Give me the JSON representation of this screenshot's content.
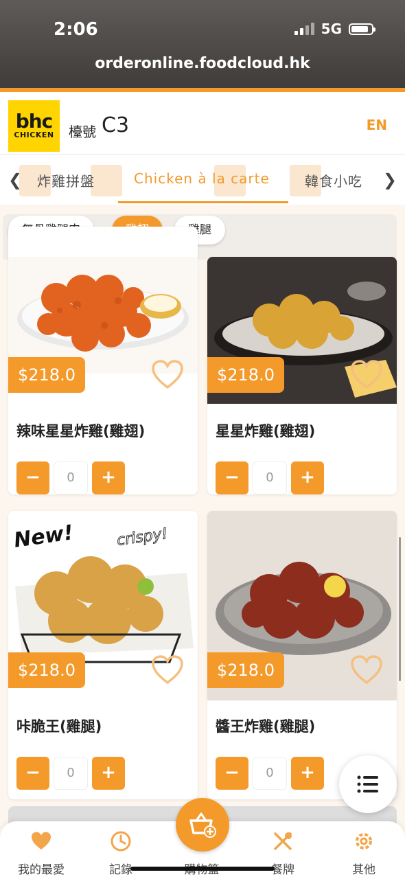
{
  "status_bar": {
    "time": "2:06",
    "network": "5G"
  },
  "browser": {
    "url": "orderonline.foodcloud.hk"
  },
  "header": {
    "logo_line1": "bhc",
    "logo_line2": "CHICKEN",
    "table_label": "檯號",
    "table_number": "C3",
    "lang_button": "EN"
  },
  "categories": {
    "items": [
      {
        "label": "炸雞拼盤"
      },
      {
        "label": "Chicken à la carte"
      },
      {
        "label": "韓食小吃"
      }
    ],
    "active": "Chicken à la carte"
  },
  "chips": [
    {
      "label": "無骨雞腿肉"
    },
    {
      "label": "雞翅"
    },
    {
      "label": "雞腿"
    }
  ],
  "products": [
    {
      "name": "辣味星星炸雞(雞翅)",
      "price": "$218.0",
      "qty": "0"
    },
    {
      "name": "星星炸雞(雞翅)",
      "price": "$218.0",
      "qty": "0"
    },
    {
      "name": "咔脆王(雞腿)",
      "price": "$218.0",
      "qty": "0",
      "badge_new": "New!",
      "badge_crispy": "crispy!"
    },
    {
      "name": "醬王炸雞(雞腿)",
      "price": "$218.0",
      "qty": "0"
    }
  ],
  "bottom_nav": [
    {
      "label": "我的最愛",
      "icon": "heart-icon"
    },
    {
      "label": "記錄",
      "icon": "clock-icon"
    },
    {
      "label": "購物籃",
      "icon": "basket-icon"
    },
    {
      "label": "餐牌",
      "icon": "fork-knife-icon"
    },
    {
      "label": "其他",
      "icon": "gear-icon"
    }
  ],
  "colors": {
    "accent": "#f39a2b",
    "logo_yellow": "#ffd400"
  }
}
